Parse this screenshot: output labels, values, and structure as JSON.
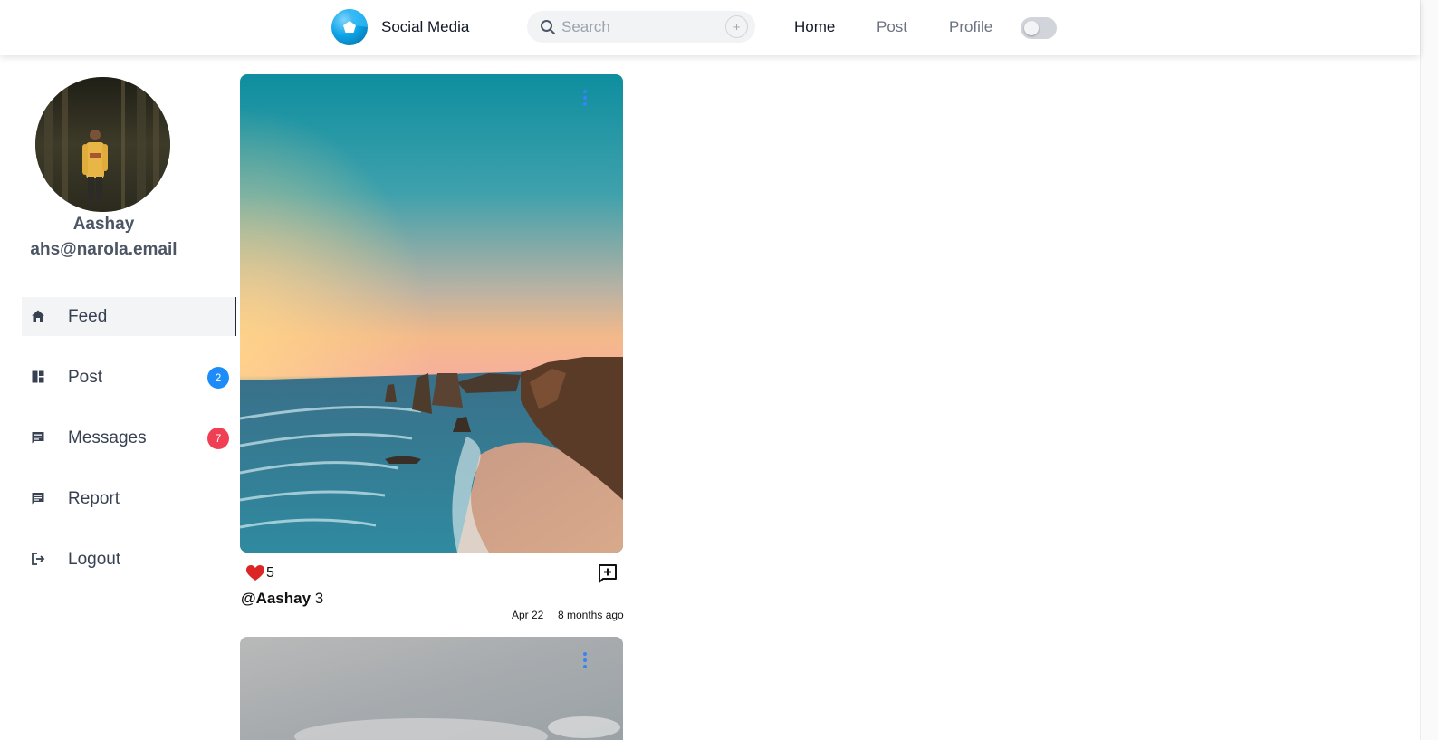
{
  "header": {
    "brand": "Social Media",
    "search_placeholder": "Search",
    "plus_label": "+",
    "nav": {
      "home": "Home",
      "post": "Post",
      "profile": "Profile"
    },
    "dark_mode_toggle": false
  },
  "user": {
    "name": "Aashay",
    "email": "ahs@narola.email"
  },
  "sidebar": {
    "items": [
      {
        "label": "Feed",
        "icon": "home-icon",
        "active": true
      },
      {
        "label": "Post",
        "icon": "dashboard-icon",
        "badge": "2",
        "badge_color": "#1d8cf8"
      },
      {
        "label": "Messages",
        "icon": "message-icon",
        "badge": "7",
        "badge_color": "#f03e54"
      },
      {
        "label": "Report",
        "icon": "report-icon"
      },
      {
        "label": "Logout",
        "icon": "logout-icon"
      }
    ]
  },
  "feed": {
    "posts": [
      {
        "likes": "5",
        "author": "@Aashay",
        "caption": "3",
        "date": "Apr 22",
        "ago": "8 months ago"
      }
    ]
  },
  "colors": {
    "accent": "#3b82f6",
    "heart": "#dc2626",
    "badge_blue": "#1d8cf8",
    "badge_red": "#f03e54"
  }
}
